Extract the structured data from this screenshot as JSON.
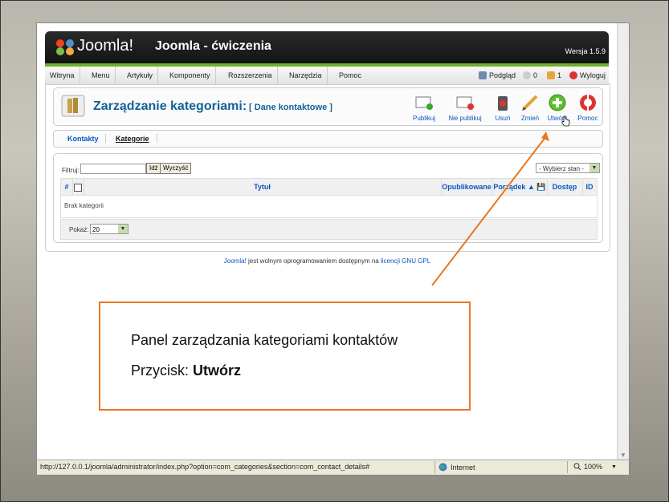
{
  "header": {
    "logo_text": "Joomla!",
    "site_title": "Joomla - ćwiczenia",
    "version": "Wersja 1.5.9"
  },
  "menubar": {
    "items": [
      "Witryna",
      "Menu",
      "Artykuły",
      "Komponenty",
      "Rozszerzenia",
      "Narzędzia",
      "Pomoc"
    ],
    "preview": "Podgląd",
    "messages_count": "0",
    "users_count": "1",
    "logout": "Wyloguj"
  },
  "toolbar": {
    "title": "Zarządzanie kategoriami:",
    "subtitle": "[ Dane kontaktowe ]",
    "buttons": {
      "publish": "Publikuj",
      "unpublish": "Nie publikuj",
      "delete": "Usuń",
      "edit": "Zmień",
      "new": "Utwórz",
      "help": "Pomoc"
    }
  },
  "tabs": [
    "Kontakty",
    "Kategorie"
  ],
  "filter": {
    "label": "Filtruj:",
    "value": "",
    "go": "Idź",
    "reset": "Wyczyść",
    "state_select": "- Wybierz stan -"
  },
  "table": {
    "columns": {
      "num": "#",
      "title": "Tytuł",
      "published": "Opublikowane",
      "order": "Porządek",
      "access": "Dostęp",
      "id": "ID"
    },
    "empty_message": "Brak kategorii"
  },
  "pager": {
    "label": "Pokaż:",
    "value": "20"
  },
  "footer": {
    "brand": "Joomla!",
    "text": " jest wolnym oprogramowaniem dostępnym na ",
    "license": "licencji GNU GPL"
  },
  "statusbar": {
    "url": "http://127.0.0.1/joomla/administrator/index.php?option=com_categories&section=com_contact_details#",
    "zone": "Internet",
    "zoom": "100%"
  },
  "annotation": {
    "line1": "Panel zarządzania kategoriami kontaktów",
    "line2_prefix": "Przycisk: ",
    "line2_bold": "Utwórz"
  },
  "colors": {
    "accent": "#e87722",
    "link": "#0b55c4",
    "title": "#146295",
    "header_green": "#6fb02f"
  }
}
